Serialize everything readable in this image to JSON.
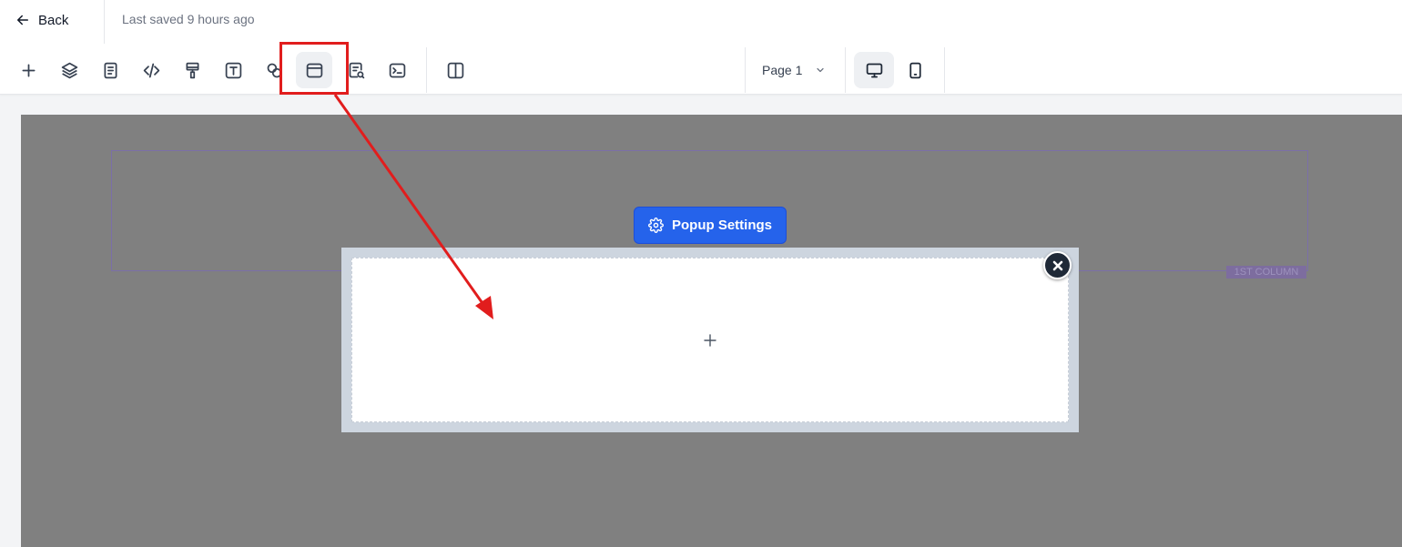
{
  "header": {
    "back_label": "Back",
    "saved_status": "Last saved 9 hours ago"
  },
  "toolbar": {
    "tools": [
      {
        "icon": "plus-icon"
      },
      {
        "icon": "layers-icon"
      },
      {
        "icon": "page-icon"
      },
      {
        "icon": "code-icon"
      },
      {
        "icon": "paint-roller-icon"
      },
      {
        "icon": "text-box-icon"
      },
      {
        "icon": "shapes-icon"
      },
      {
        "icon": "popup-icon",
        "active": true
      },
      {
        "icon": "seo-search-icon"
      },
      {
        "icon": "terminal-icon"
      },
      {
        "icon": "split-view-icon"
      }
    ],
    "page_select": "Page 1",
    "devices": [
      {
        "icon": "desktop-icon",
        "active": true
      },
      {
        "icon": "mobile-icon"
      }
    ]
  },
  "canvas": {
    "column_tag": "1ST COLUMN",
    "popup_settings_label": "Popup Settings",
    "popup_add_icon": "plus-icon",
    "popup_close_icon": "close-icon"
  },
  "colors": {
    "accent_blue": "#2563eb",
    "canvas_overlay": "#808080",
    "annotation_red": "#e11d1d"
  }
}
